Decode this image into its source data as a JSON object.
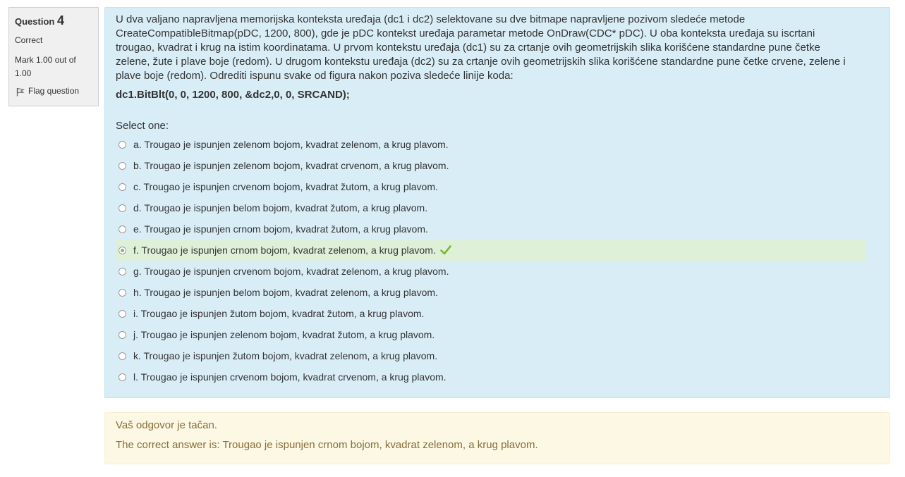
{
  "info": {
    "question_label": "Question",
    "question_number": "4",
    "state": "Correct",
    "grade": "Mark 1.00 out of 1.00",
    "flag_label": "Flag question"
  },
  "question": {
    "text": "U dva valjano napravljena memorijska konteksta uređaja (dc1 i dc2) selektovane su dve bitmape napravljene pozivom sledeće metode CreateCompatibleBitmap(pDC, 1200, 800), gde je pDC kontekst uređaja parametar metode OnDraw(CDC* pDC). U oba konteksta uređaja su iscrtani trougao, kvadrat i krug na istim koordinatama. U prvom kontekstu uređaja (dc1) su za crtanje ovih geometrijskih slika korišćene standardne pune četke zelene, žute i plave boje (redom). U drugom kontekstu uređaja (dc2) su za crtanje ovih geometrijskih slika korišćene standardne pune četke crvene, zelene i plave boje (redom). Odrediti ispunu svake od figura nakon poziva sledeće linije koda:",
    "code": "dc1.BitBlt(0, 0, 1200, 800, &dc2,0, 0, SRCAND);",
    "prompt": "Select one:"
  },
  "options": [
    {
      "label": "a. Trougao je ispunjen zelenom bojom, kvadrat zelenom, a krug plavom."
    },
    {
      "label": "b. Trougao je ispunjen zelenom bojom, kvadrat crvenom, a krug plavom."
    },
    {
      "label": "c. Trougao je ispunjen crvenom bojom, kvadrat žutom, a krug plavom."
    },
    {
      "label": "d. Trougao je ispunjen belom bojom, kvadrat žutom, a krug plavom."
    },
    {
      "label": "e. Trougao je ispunjen crnom bojom, kvadrat žutom, a krug plavom."
    },
    {
      "label": "f. Trougao je ispunjen crnom bojom, kvadrat zelenom, a krug plavom."
    },
    {
      "label": "g. Trougao je ispunjen crvenom bojom, kvadrat zelenom, a krug plavom."
    },
    {
      "label": "h. Trougao je ispunjen belom bojom, kvadrat zelenom, a krug plavom."
    },
    {
      "label": "i. Trougao je ispunjen žutom bojom, kvadrat žutom, a krug plavom."
    },
    {
      "label": "j. Trougao je ispunjen zelenom bojom, kvadrat žutom, a krug plavom."
    },
    {
      "label": "k. Trougao je ispunjen žutom bojom, kvadrat zelenom, a krug plavom."
    },
    {
      "label": "l. Trougao je ispunjen crvenom bojom, kvadrat crvenom, a krug plavom."
    }
  ],
  "selected_option": "f",
  "feedback": {
    "result": "Vaš odgovor je tačan.",
    "correct_answer": "The correct answer is: Trougao je ispunjen crnom bojom, kvadrat zelenom, a krug plavom."
  },
  "colors": {
    "info_bg": "#f0f0f0",
    "question_bg": "#d9edf7",
    "correct_bg": "#dff0d8",
    "check": "#7ab832",
    "feedback_bg": "#fcf8e3",
    "feedback_text": "#8a6d3b"
  },
  "icons": {
    "flag": "flag-icon",
    "correct": "checkmark-icon"
  }
}
